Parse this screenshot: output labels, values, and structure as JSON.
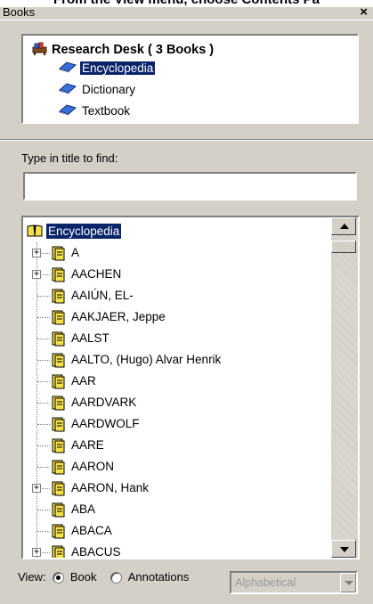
{
  "cut_text": "From the View menu, choose Contents Pa",
  "window": {
    "title": "Books",
    "close_glyph": "×"
  },
  "books": {
    "root": "Research Desk ( 3 Books )",
    "items": [
      "Encyclopedia",
      "Dictionary",
      "Textbook"
    ],
    "selected": "Encyclopedia"
  },
  "find": {
    "label": "Type in title to find:",
    "value": ""
  },
  "tree": {
    "root": "Encyclopedia",
    "entries": [
      {
        "label": "A",
        "expandable": true
      },
      {
        "label": "AACHEN",
        "expandable": true
      },
      {
        "label": "AAIÚN, EL-",
        "expandable": false
      },
      {
        "label": "AAKJAER, Jeppe",
        "expandable": false
      },
      {
        "label": "AALST",
        "expandable": false
      },
      {
        "label": "AALTO, (Hugo) Alvar Henrik",
        "expandable": false
      },
      {
        "label": "AAR",
        "expandable": false
      },
      {
        "label": "AARDVARK",
        "expandable": false
      },
      {
        "label": "AARDWOLF",
        "expandable": false
      },
      {
        "label": "AARE",
        "expandable": false
      },
      {
        "label": "AARON",
        "expandable": false
      },
      {
        "label": "AARON, Hank",
        "expandable": true
      },
      {
        "label": "ABA",
        "expandable": false
      },
      {
        "label": "ABACA",
        "expandable": false
      },
      {
        "label": "ABACUS",
        "expandable": true
      }
    ]
  },
  "view": {
    "label": "View:",
    "options": [
      "Book",
      "Annotations"
    ],
    "selected": "Book",
    "sort": "Alphabetical"
  }
}
